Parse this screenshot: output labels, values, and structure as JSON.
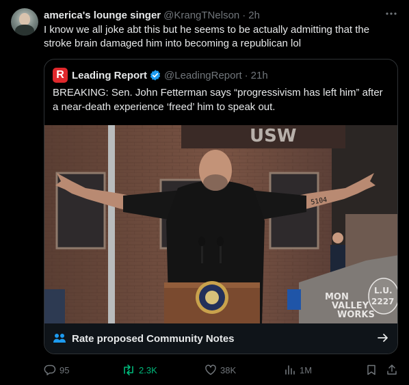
{
  "tweet": {
    "author_name": "america's lounge singer",
    "author_handle": "@KrangTNelson",
    "separator": "·",
    "time": "2h",
    "more_icon": "more-dots-icon",
    "text": "I know we all joke abt this but he seems to be actually admitting that the stroke brain damaged him into becoming a republican lol"
  },
  "quote": {
    "logo_letter": "R",
    "author_name": "Leading Report",
    "author_handle": "@LeadingReport",
    "separator": "·",
    "time": "21h",
    "verified_icon": "verified-badge-icon",
    "text": "BREAKING: Sen. John Fetterman says “progressivism has left him” after a near-death experience ‘freed’ him to speak out.",
    "image": {
      "sign_text": "USW",
      "tattoo_right": "5104",
      "rock_text_1": "MON",
      "rock_text_2": "VALLEY",
      "rock_text_3": "WORKS",
      "rock_text_4": "L.U.",
      "rock_text_5": "2227"
    }
  },
  "community_notes": {
    "label": "Rate proposed Community Notes",
    "icon": "people-icon",
    "arrow_icon": "arrow-right-icon"
  },
  "actions": {
    "replies": "95",
    "retweets": "2.3K",
    "likes": "38K",
    "views": "1M"
  },
  "colors": {
    "background": "#000000",
    "text": "#e7e9ea",
    "muted": "#71767b",
    "accent": "#1d9bf0",
    "retweet": "#00ba7c",
    "border": "#2f3336"
  }
}
